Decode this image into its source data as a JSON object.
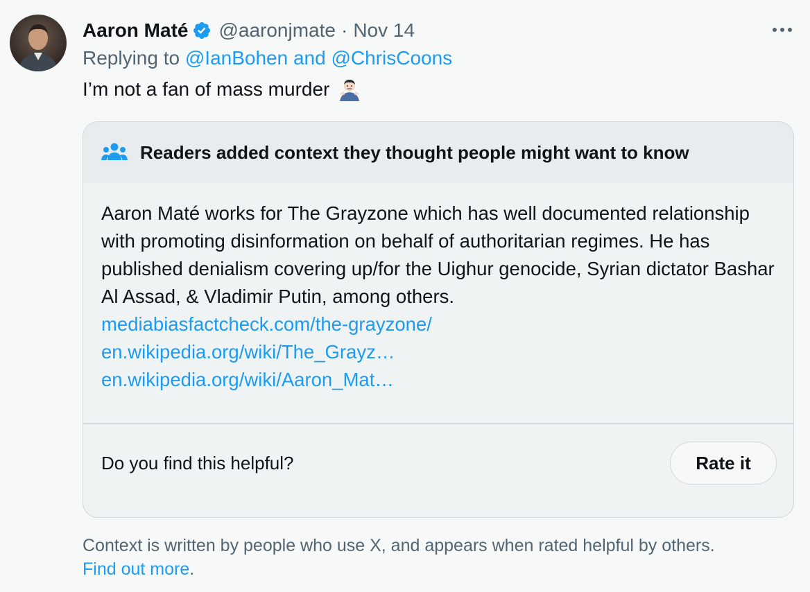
{
  "author": {
    "display_name": "Aaron Maté",
    "handle": "@aaronjmate",
    "separator": "·",
    "date": "Nov 14",
    "verified_icon": "verified-badge-icon"
  },
  "reply": {
    "prefix": "Replying to",
    "user1": "@IanBohen",
    "connector": "and",
    "user2": "@ChrisCoons"
  },
  "tweet": {
    "text": "I’m not a fan of mass murder",
    "emoji": "man-shrugging-emoji"
  },
  "note": {
    "title": "Readers added context they thought people might want to know",
    "body": "Aaron Maté works for The Grayzone which has well documented relationship with promoting disinformation on behalf of authoritarian regimes. He has published denialism covering up/for the Uighur genocide, Syrian dictator Bashar Al Assad, & Vladimir Putin, among others.",
    "links": [
      "mediabiasfactcheck.com/the-grayzone/",
      "en.wikipedia.org/wiki/The_Grayz…",
      "en.wikipedia.org/wiki/Aaron_Mat…"
    ],
    "question": "Do you find this helpful?",
    "rate_label": "Rate it"
  },
  "disclaimer": {
    "text": "Context is written by people who use X, and appears when rated helpful by others.",
    "link": "Find out more",
    "suffix": "."
  },
  "colors": {
    "link": "#1d9bf0",
    "secondary_text": "#536471",
    "verified": "#1d9bf0"
  }
}
